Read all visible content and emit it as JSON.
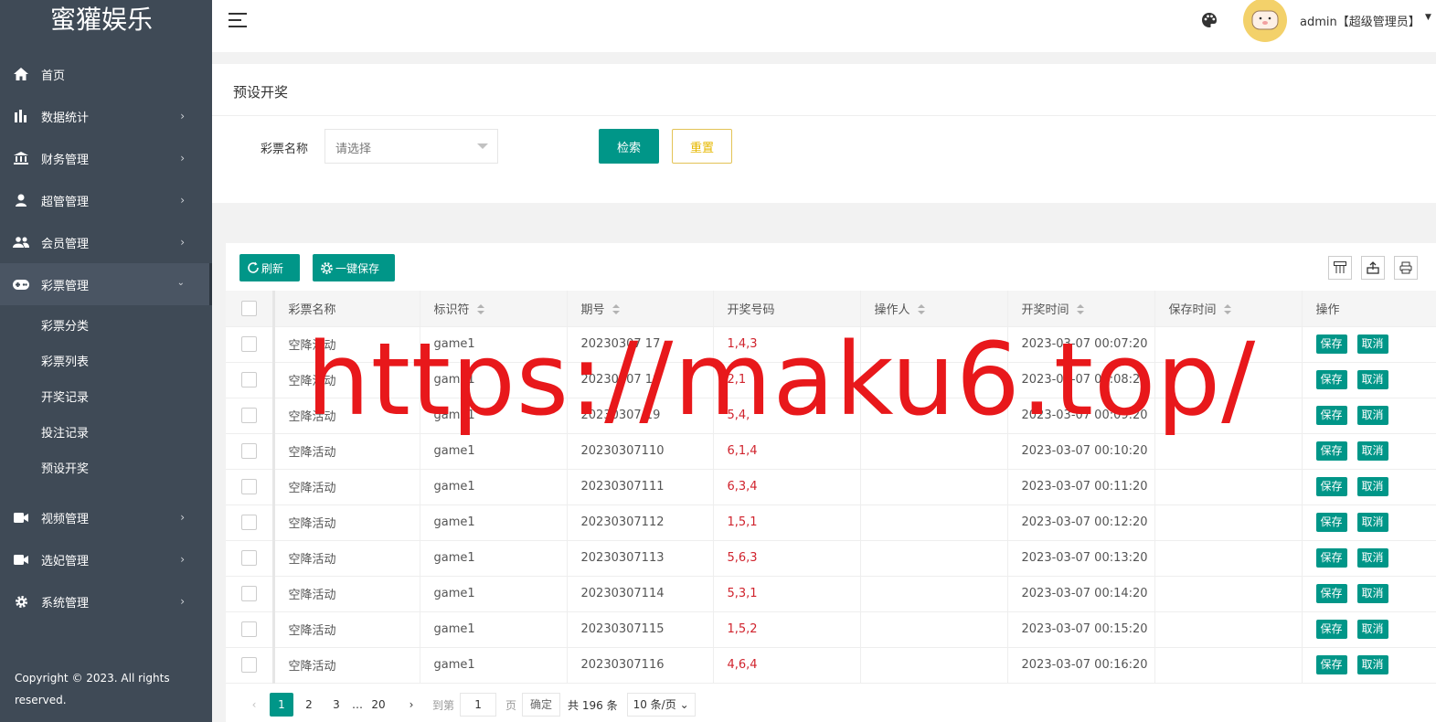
{
  "brand": "蜜獾娱乐",
  "sidebar": {
    "items": [
      {
        "label": "首页",
        "icon": "home-icon"
      },
      {
        "label": "数据统计",
        "icon": "bar-chart-icon"
      },
      {
        "label": "财务管理",
        "icon": "bank-icon"
      },
      {
        "label": "超管管理",
        "icon": "user-icon"
      },
      {
        "label": "会员管理",
        "icon": "users-icon"
      },
      {
        "label": "彩票管理",
        "icon": "gamepad-icon"
      }
    ],
    "subitems": [
      "彩票分类",
      "彩票列表",
      "开奖记录",
      "投注记录",
      "预设开奖"
    ],
    "items_after": [
      {
        "label": "视频管理",
        "icon": "video-icon"
      },
      {
        "label": "选妃管理",
        "icon": "video-icon"
      },
      {
        "label": "系统管理",
        "icon": "gear-icon"
      }
    ],
    "copyright_line1": "Copyright © 2023. All rights",
    "copyright_line2": "reserved."
  },
  "header": {
    "user_label": "admin【超级管理员】"
  },
  "search": {
    "title": "预设开奖",
    "field_label": "彩票名称",
    "placeholder": "请选择",
    "search_label": "检索",
    "reset_label": "重置"
  },
  "toolbar": {
    "refresh_label": "刷新",
    "save_all_label": "一键保存"
  },
  "table": {
    "columns": [
      "彩票名称",
      "标识符",
      "期号",
      "开奖号码",
      "操作人",
      "开奖时间",
      "保存时间",
      "操作"
    ],
    "save_label": "保存",
    "cancel_label": "取消",
    "rows": [
      {
        "name": "空降活动",
        "id": "game1",
        "period": "20230307 17",
        "numbers": "1,4,3",
        "operator": "",
        "draw_time": "2023-03-07 00:07:20",
        "save_time": ""
      },
      {
        "name": "空降活动",
        "id": "game1",
        "period": "20230307 18",
        "numbers": "2,1",
        "operator": "",
        "draw_time": "2023-03-07 00:08:20",
        "save_time": ""
      },
      {
        "name": "空降活动",
        "id": "game1",
        "period": "20230307 19",
        "numbers": "5,4,",
        "operator": "",
        "draw_time": "2023-03-07 00:09:20",
        "save_time": ""
      },
      {
        "name": "空降活动",
        "id": "game1",
        "period": "20230307110",
        "numbers": "6,1,4",
        "operator": "",
        "draw_time": "2023-03-07 00:10:20",
        "save_time": ""
      },
      {
        "name": "空降活动",
        "id": "game1",
        "period": "20230307111",
        "numbers": "6,3,4",
        "operator": "",
        "draw_time": "2023-03-07 00:11:20",
        "save_time": ""
      },
      {
        "name": "空降活动",
        "id": "game1",
        "period": "20230307112",
        "numbers": "1,5,1",
        "operator": "",
        "draw_time": "2023-03-07 00:12:20",
        "save_time": ""
      },
      {
        "name": "空降活动",
        "id": "game1",
        "period": "20230307113",
        "numbers": "5,6,3",
        "operator": "",
        "draw_time": "2023-03-07 00:13:20",
        "save_time": ""
      },
      {
        "name": "空降活动",
        "id": "game1",
        "period": "20230307114",
        "numbers": "5,3,1",
        "operator": "",
        "draw_time": "2023-03-07 00:14:20",
        "save_time": ""
      },
      {
        "name": "空降活动",
        "id": "game1",
        "period": "20230307115",
        "numbers": "1,5,2",
        "operator": "",
        "draw_time": "2023-03-07 00:15:20",
        "save_time": ""
      },
      {
        "name": "空降活动",
        "id": "game1",
        "period": "20230307116",
        "numbers": "4,6,4",
        "operator": "",
        "draw_time": "2023-03-07 00:16:20",
        "save_time": ""
      }
    ]
  },
  "pagination": {
    "pages": [
      "1",
      "2",
      "3",
      "…",
      "20"
    ],
    "current": "1",
    "goto_label": "到第",
    "goto_value": "1",
    "page_unit": "页",
    "confirm_label": "确定",
    "total_label": "共 196 条",
    "per_page": "10 条/页"
  },
  "watermark": "https://maku6.top/",
  "colors": {
    "sidebar_bg": "#3f4a56",
    "primary": "#009688",
    "reset_border": "#e3c356",
    "numbers_red": "#d0232d",
    "watermark_red": "#e8181b"
  }
}
